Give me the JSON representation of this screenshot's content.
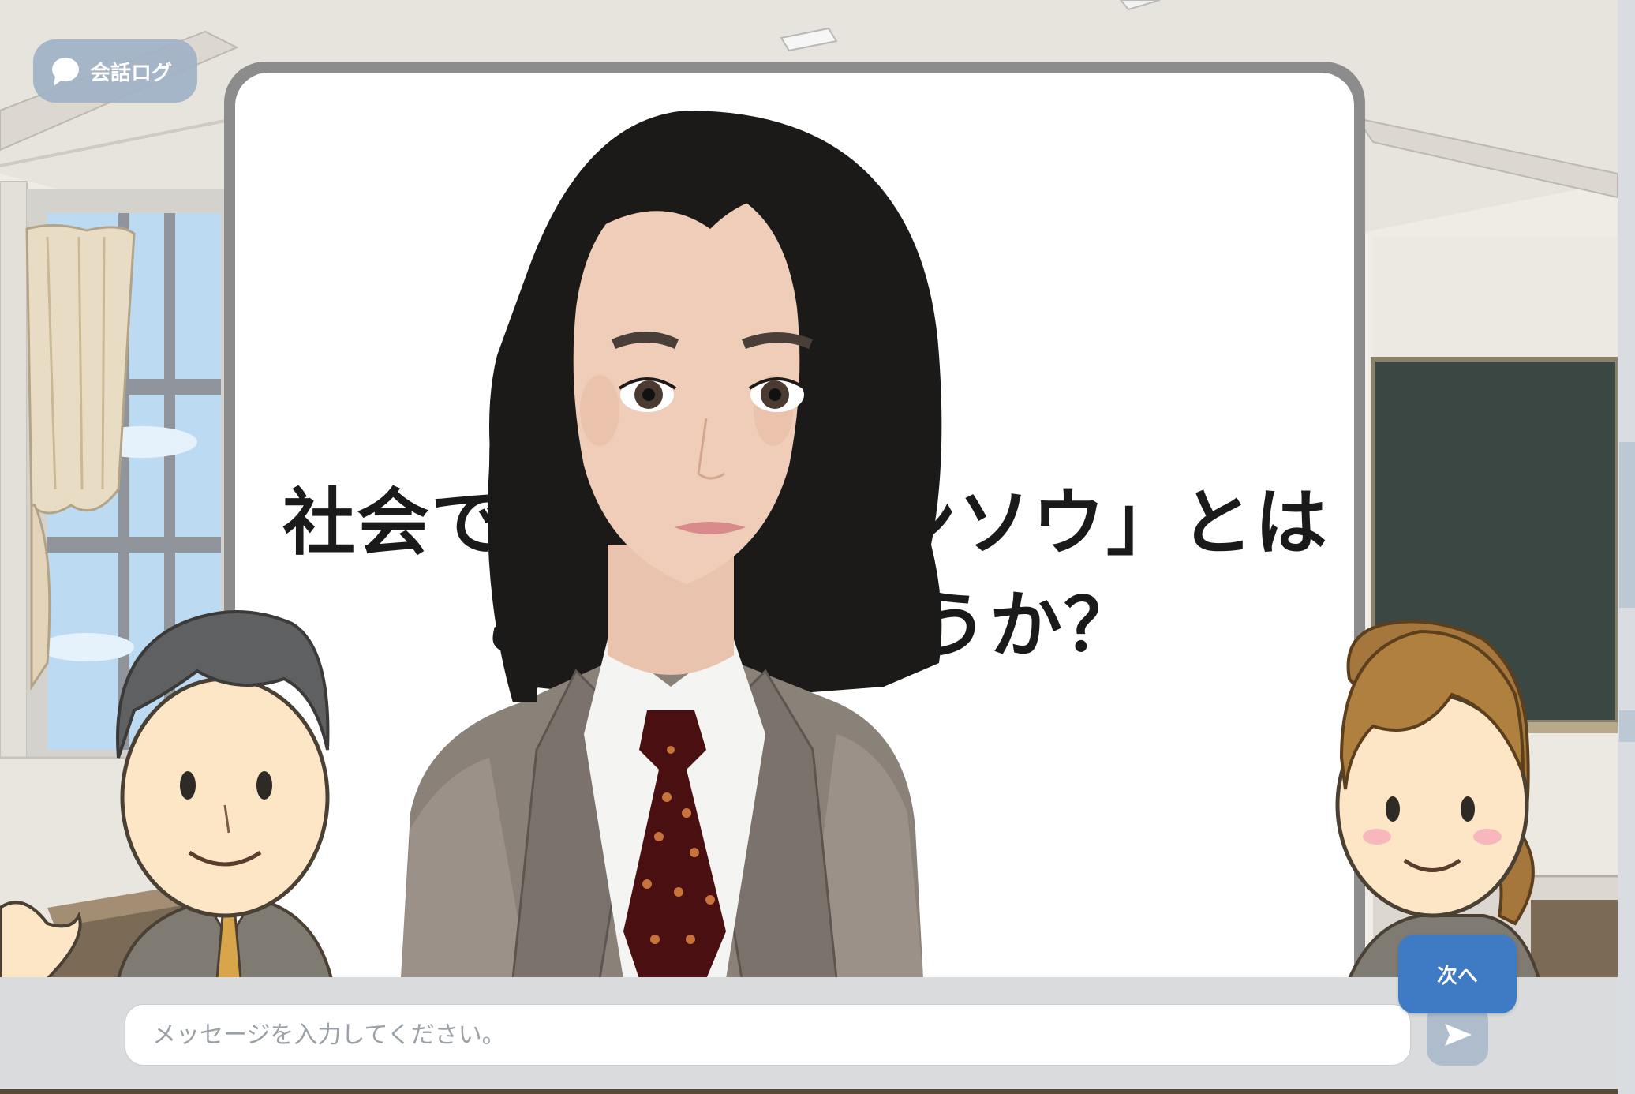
{
  "header": {
    "chat_log_label": "会話ログ"
  },
  "whiteboard": {
    "line1_left": "社会での",
    "line1_right": "ンソウ」とは",
    "line2_left": "こ",
    "line2_right": "うか？"
  },
  "message_bar": {
    "placeholder": "メッセージを入力してください。",
    "value": ""
  },
  "buttons": {
    "next_label": "次へ"
  },
  "icons": {
    "chat_log": "speech-bubble-icon",
    "send": "send-arrow-icon"
  },
  "colors": {
    "next_button": "#3e7bc4",
    "send_button": "#aebccb",
    "log_button": "#a0b2c6"
  }
}
